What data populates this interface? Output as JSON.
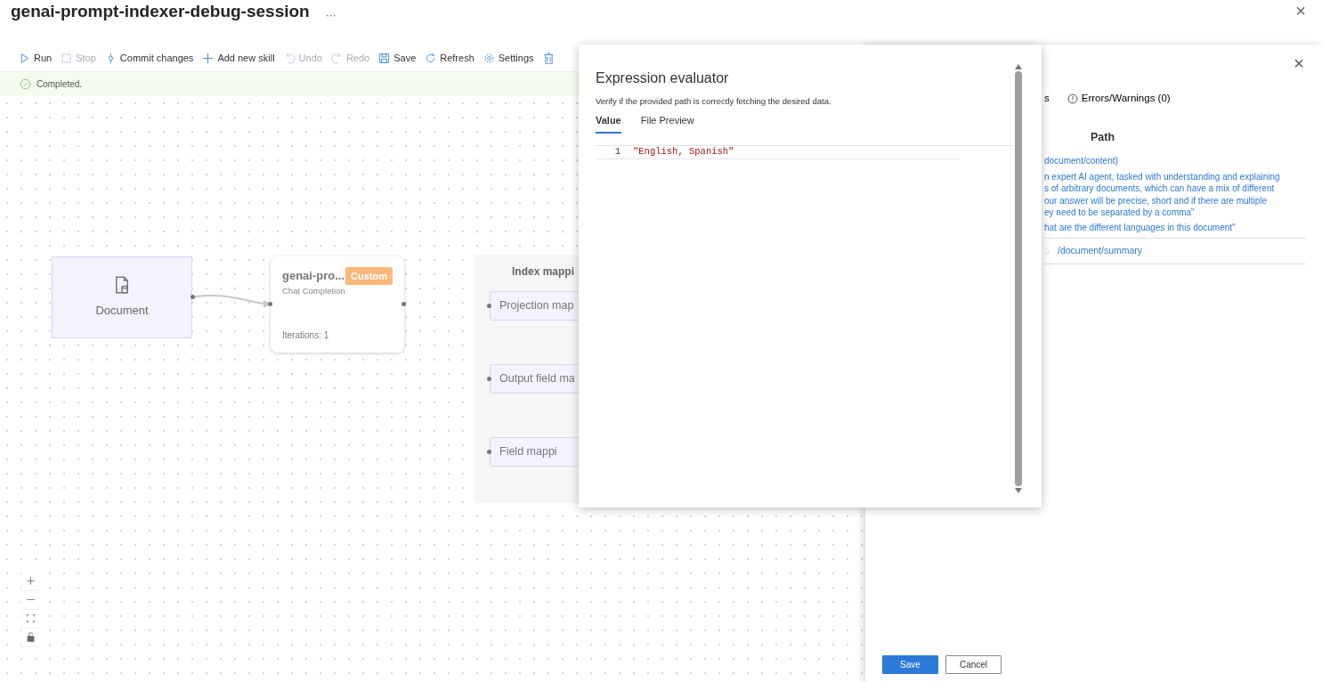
{
  "header": {
    "title": "genai-prompt-indexer-debug-session",
    "more": "···",
    "close": "×"
  },
  "toolbar": [
    {
      "kind": "run",
      "label": "Run",
      "disabled": false
    },
    {
      "kind": "stop",
      "label": "Stop",
      "disabled": true
    },
    {
      "kind": "commit",
      "label": "Commit changes",
      "disabled": false
    },
    {
      "kind": "add",
      "label": "Add new skill",
      "disabled": false
    },
    {
      "kind": "undo",
      "label": "Undo",
      "disabled": true
    },
    {
      "kind": "redo",
      "label": "Redo",
      "disabled": true
    },
    {
      "kind": "save",
      "label": "Save",
      "disabled": false
    },
    {
      "kind": "refresh",
      "label": "Refresh",
      "disabled": false
    },
    {
      "kind": "settings",
      "label": "Settings",
      "disabled": false
    },
    {
      "kind": "delete",
      "disabled": false
    }
  ],
  "status": {
    "kind": "success",
    "text": "Completed."
  },
  "canvas": {
    "source": {
      "label": "Document"
    },
    "skill": {
      "title": "genai-pro...",
      "badge": "Custom",
      "subtitle": "Chat Completion",
      "iterations": "Iterations: 1"
    },
    "group": {
      "title": "Index mappi",
      "items": [
        "Projection map",
        "Output field ma",
        "Field mappi"
      ]
    }
  },
  "panel": {
    "close": "×",
    "tabs": [
      {
        "kind": "plain",
        "label": "s"
      },
      {
        "kind": "errors",
        "label": "Errors/Warnings (0)"
      }
    ],
    "column_header": "Path",
    "lines": [
      "document/content)",
      "n expert AI agent, tasked with understanding and explaining",
      "s of arbitrary documents, which can have a mix of different",
      "our answer will be precise, short and if there are multiple",
      "ey need to be separated by a comma\"",
      "hat are the different languages in this document\""
    ],
    "output": "/document/summary",
    "buttons": [
      {
        "label": "Save",
        "primary": true
      },
      {
        "label": "Cancel",
        "primary": false
      }
    ]
  },
  "dialog": {
    "title": "Expression evaluator",
    "description": "Verify if the provided path is correctly fetching the desired data.",
    "tabs": [
      {
        "label": "Value",
        "selected": true
      },
      {
        "label": "File Preview",
        "selected": false
      }
    ],
    "editor": [
      {
        "line": "1",
        "code": "\"English, Spanish\""
      }
    ]
  }
}
